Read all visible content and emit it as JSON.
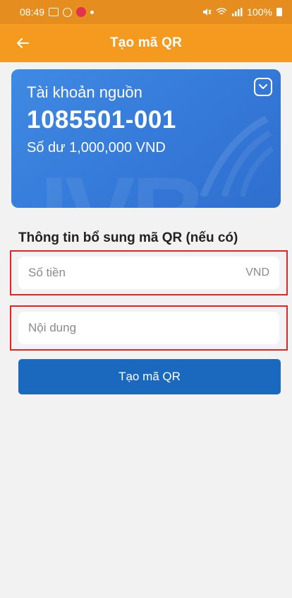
{
  "status_bar": {
    "time": "08:49",
    "battery": "100%",
    "icons": [
      "gallery-icon",
      "alarm-icon",
      "app-notification-icon",
      "dot-icon",
      "mute-icon",
      "wifi-icon",
      "signal-icon",
      "battery-icon"
    ]
  },
  "app_bar": {
    "title": "Tạo mã QR",
    "back_icon": "arrow-left-icon"
  },
  "account_card": {
    "label": "Tài khoản nguồn",
    "account_number": "1085501-001",
    "balance": "Số dư 1,000,000 VND",
    "toggle_icon": "chevron-down-icon",
    "colors": {
      "card": "#3478d8"
    }
  },
  "qr_info": {
    "section_title": "Thông tin bổ sung mã QR (nếu có)",
    "amount": {
      "placeholder": "Số tiền",
      "value": "",
      "suffix": "VND"
    },
    "content": {
      "placeholder": "Nội dung",
      "value": ""
    }
  },
  "submit_label": "Tạo mã QR",
  "colors": {
    "status_bar": "#e58e1f",
    "app_bar": "#f39a1f",
    "primary_button": "#1a69bf",
    "highlight_border": "#e02626"
  }
}
